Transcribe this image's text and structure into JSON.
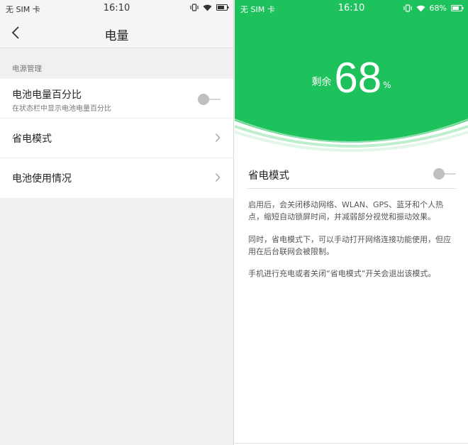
{
  "left_screen": {
    "status": {
      "carrier": "无 SIM 卡",
      "time": "16:10"
    },
    "header": {
      "title": "电量"
    },
    "section_label": "电源管理",
    "items": [
      {
        "label": "电池电量百分比",
        "sublabel": "在状态栏中显示电池电量百分比",
        "control": "toggle",
        "checked": false
      },
      {
        "label": "省电模式",
        "control": "chevron"
      },
      {
        "label": "电池使用情况",
        "control": "chevron"
      }
    ]
  },
  "right_screen": {
    "status": {
      "carrier": "无 SIM 卡",
      "time": "16:10",
      "battery_percent_text": "68%"
    },
    "battery": {
      "prefix": "剩余",
      "value": "68",
      "unit": "%"
    },
    "power_saving": {
      "label": "省电模式",
      "checked": false
    },
    "descriptions": [
      "启用后，会关闭移动网络、WLAN、GPS、蓝牙和个人热点，缩短自动锁屏时间，并减弱部分视觉和振动效果。",
      "同时，省电模式下，可以手动打开网络连接功能使用，但应用在后台联网会被限制。",
      "手机进行充电或者关闭“省电模式”开关会退出该模式。"
    ]
  },
  "colors": {
    "accent_green": "#1ec25c",
    "toggle_off": "#bfbfbf",
    "list_background": "#f0f0f2"
  }
}
